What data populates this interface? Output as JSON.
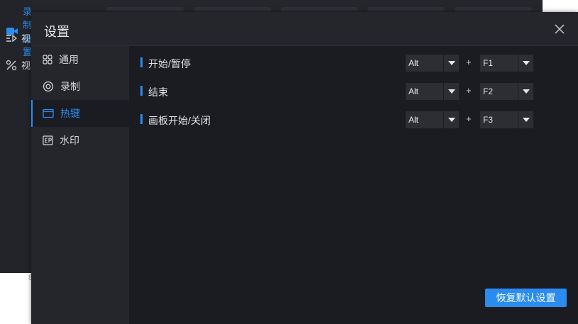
{
  "background_app": {
    "sidebar": {
      "items": [
        {
          "label": "录制设置",
          "icon": "camera-icon"
        },
        {
          "label": "视",
          "icon": "playlist-icon"
        },
        {
          "label": "视",
          "icon": "tools-icon"
        }
      ]
    },
    "bottom_glyph": "8"
  },
  "dialog": {
    "title": "设置",
    "close_icon": "close-icon",
    "nav": {
      "items": [
        {
          "label": "通用",
          "icon": "grid-icon"
        },
        {
          "label": "录制",
          "icon": "record-icon"
        },
        {
          "label": "热键",
          "icon": "window-icon",
          "active": true
        },
        {
          "label": "水印",
          "icon": "watermark-icon"
        }
      ]
    },
    "hotkeys": [
      {
        "label": "开始/暂停",
        "modifier": "Alt",
        "key": "F1"
      },
      {
        "label": "结束",
        "modifier": "Alt",
        "key": "F2"
      },
      {
        "label": "画板开始/关闭",
        "modifier": "Alt",
        "key": "F3"
      }
    ],
    "plus_sign": "+",
    "reset_button": "恢复默认设置"
  },
  "colors": {
    "accent": "#2b8cf0",
    "dialog_bg": "#1b1c21",
    "panel_bg": "#24262c",
    "select_bg": "#2c2e33"
  }
}
